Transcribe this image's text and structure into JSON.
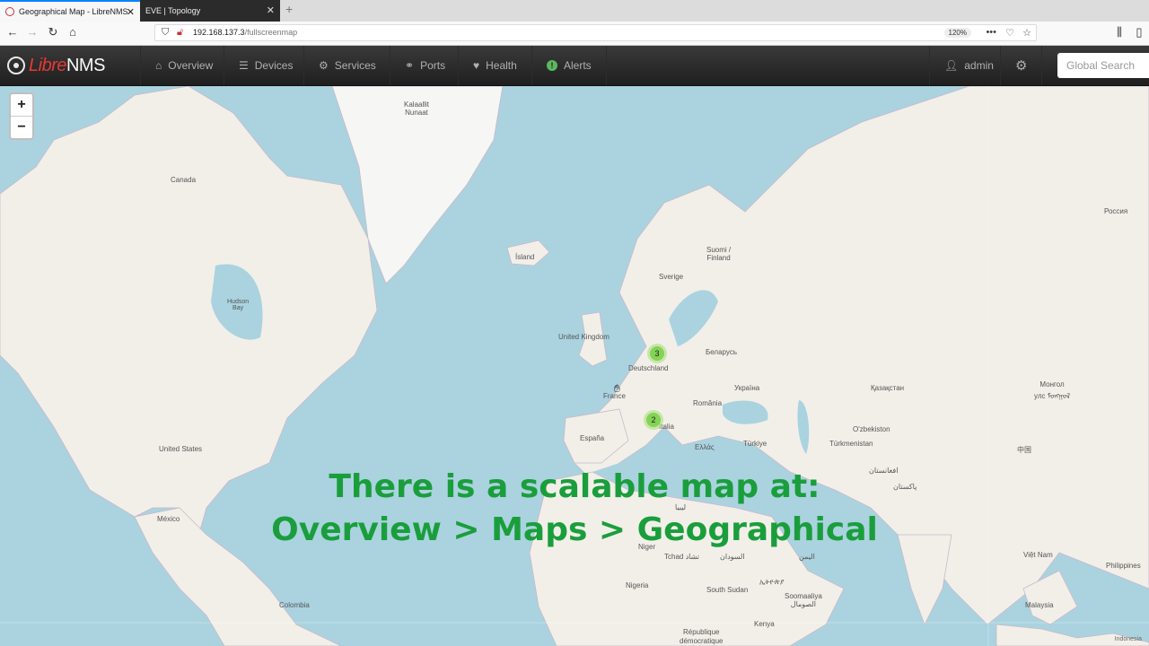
{
  "browser": {
    "tabs": [
      {
        "title": "Geographical Map - LibreNMS",
        "active": true
      },
      {
        "title": "EVE | Topology",
        "active": false
      }
    ],
    "url_host": "192.168.137.3",
    "url_path": "/fullscreenmap",
    "zoom": "120%"
  },
  "app": {
    "brand_libre": "Libre",
    "brand_nms": "NMS",
    "menu": [
      {
        "label": "Overview",
        "icon": "home-icon"
      },
      {
        "label": "Devices",
        "icon": "server-icon"
      },
      {
        "label": "Services",
        "icon": "cogs-icon"
      },
      {
        "label": "Ports",
        "icon": "link-icon"
      },
      {
        "label": "Health",
        "icon": "heartbeat-icon"
      },
      {
        "label": "Alerts",
        "icon": "exclamation-circle-icon"
      }
    ],
    "user": "admin",
    "search_placeholder": "Global Search"
  },
  "map": {
    "zoom_in": "+",
    "zoom_out": "−",
    "clusters": [
      {
        "label": "3"
      },
      {
        "label": "2"
      }
    ],
    "labels": {
      "greenland": "Kalaallit\nNunaat",
      "canada": "Canada",
      "hudson_bay": "Hudson\nBay",
      "iceland": "Ísland",
      "finland": "Suomi /\nFinland",
      "sverige": "Sverige",
      "uk": "United Kingdom",
      "deutschland": "Deutschland",
      "belarus": "Беларусь",
      "ukraine": "Україна",
      "romania": "România",
      "france": "France",
      "italia": "Italia",
      "espana": "España",
      "ellas": "Ελλάς",
      "turkiye": "Türkiye",
      "rossiya": "Россия",
      "kazakhstan": "Қазақстан",
      "mongolia": "Монгол\nулс ᠮᠣᠩᠭᠣᠯ",
      "uzbekistan": "O'zbekiston",
      "turkmenistan": "Türkmenistan",
      "afghanistan": "افغانستان",
      "pakistan": "پاکستان",
      "china": "中国",
      "us": "United States",
      "mexico": "México",
      "colombia": "Colombia",
      "niger": "Niger",
      "nigeria": "Nigeria",
      "tchad": "Tchad تشاد",
      "sudan": "السودان",
      "south_sudan": "South Sudan",
      "ethiopia": "ኢትዮጵያ",
      "somalia": "Soomaaliya\nالصومال",
      "kenya": "Kenya",
      "yemen": "اليمن",
      "libya": "ليبيا",
      "rdc": "République\ndémocratique",
      "vietnam": "Việt Nam",
      "philippines": "Philippines",
      "malaysia": "Malaysia",
      "indonesia": "Indonesia"
    },
    "attribution": "Indonesia"
  },
  "caption": {
    "line1": "There is a scalable map at:",
    "line2": "Overview > Maps > Geographical"
  }
}
